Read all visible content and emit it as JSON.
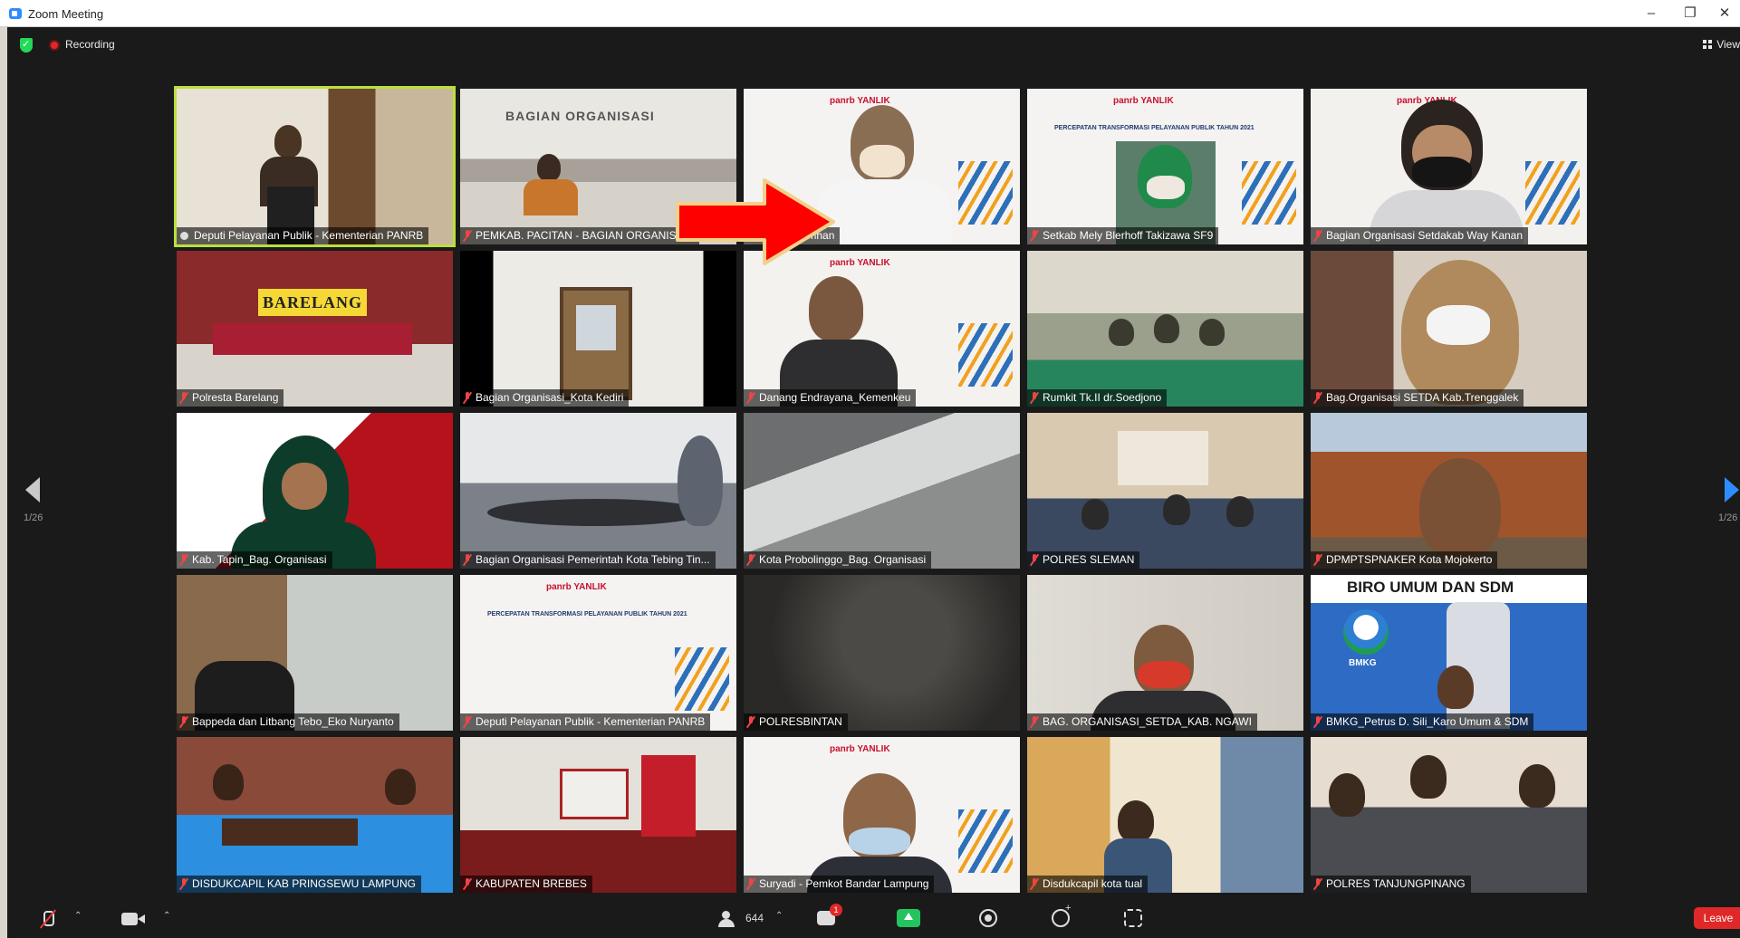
{
  "window": {
    "title": "Zoom Meeting",
    "minimize": "–",
    "restore": "❐",
    "close": "✕"
  },
  "topbar": {
    "recording_label": "Recording",
    "view_label": "View"
  },
  "pagination": {
    "left": "1/26",
    "right": "1/26"
  },
  "tiles": [
    {
      "name": "Deputi Pelayanan Publik - Kementerian PANRB",
      "active": true
    },
    {
      "name": "PEMKAB. PACITAN - BAGIAN ORGANISASI"
    },
    {
      "name": "Nova - Kemhan"
    },
    {
      "name": "Setkab Mely Blerhoff Takizawa SF9"
    },
    {
      "name": "Bagian Organisasi Setdakab Way Kanan"
    },
    {
      "name": "Polresta Barelang",
      "sign": "BARELANG"
    },
    {
      "name": "Bagian Organisasi_Kota Kediri"
    },
    {
      "name": "Danang Endrayana_Kemenkeu"
    },
    {
      "name": "Rumkit Tk.II dr.Soedjono"
    },
    {
      "name": "Bag.Organisasi SETDA Kab.Trenggalek"
    },
    {
      "name": "Kab. Tapin_Bag. Organisasi"
    },
    {
      "name": "Bagian Organisasi Pemerintah Kota Tebing Tin..."
    },
    {
      "name": "Kota Probolinggo_Bag. Organisasi"
    },
    {
      "name": "POLRES SLEMAN"
    },
    {
      "name": "DPMPTSPNAKER Kota Mojokerto"
    },
    {
      "name": "Bappeda dan Litbang Tebo_Eko Nuryanto"
    },
    {
      "name": "Deputi Pelayanan Publik - Kementerian PANRB"
    },
    {
      "name": "POLRESBINTAN"
    },
    {
      "name": "BAG. ORGANISASI_SETDA_KAB. NGAWI"
    },
    {
      "name": "BMKG_Petrus D. Sili_Karo Umum & SDM",
      "banner": "BIRO UMUM DAN SDM",
      "logo": "BMKG"
    },
    {
      "name": "DISDUKCAPIL KAB PRINGSEWU LAMPUNG"
    },
    {
      "name": "KABUPATEN BREBES"
    },
    {
      "name": "Suryadi - Pemkot Bandar Lampung"
    },
    {
      "name": "Disdukcapil kota tual"
    },
    {
      "name": "POLRES TANJUNGPINANG"
    }
  ],
  "slide": {
    "logo": "panrb YANLIK",
    "heading": "PERCEPATAN TRANSFORMASI PELAYANAN PUBLIK TAHUN 2021"
  },
  "toolbar": {
    "participants_count": "644",
    "chat_badge": "1",
    "leave_label": "Leave"
  },
  "colors": {
    "active_border": "#b9e03c",
    "accent": "#2d8cff",
    "leave": "#e02828",
    "share": "#23c45e",
    "arrow": "#ff0000"
  }
}
